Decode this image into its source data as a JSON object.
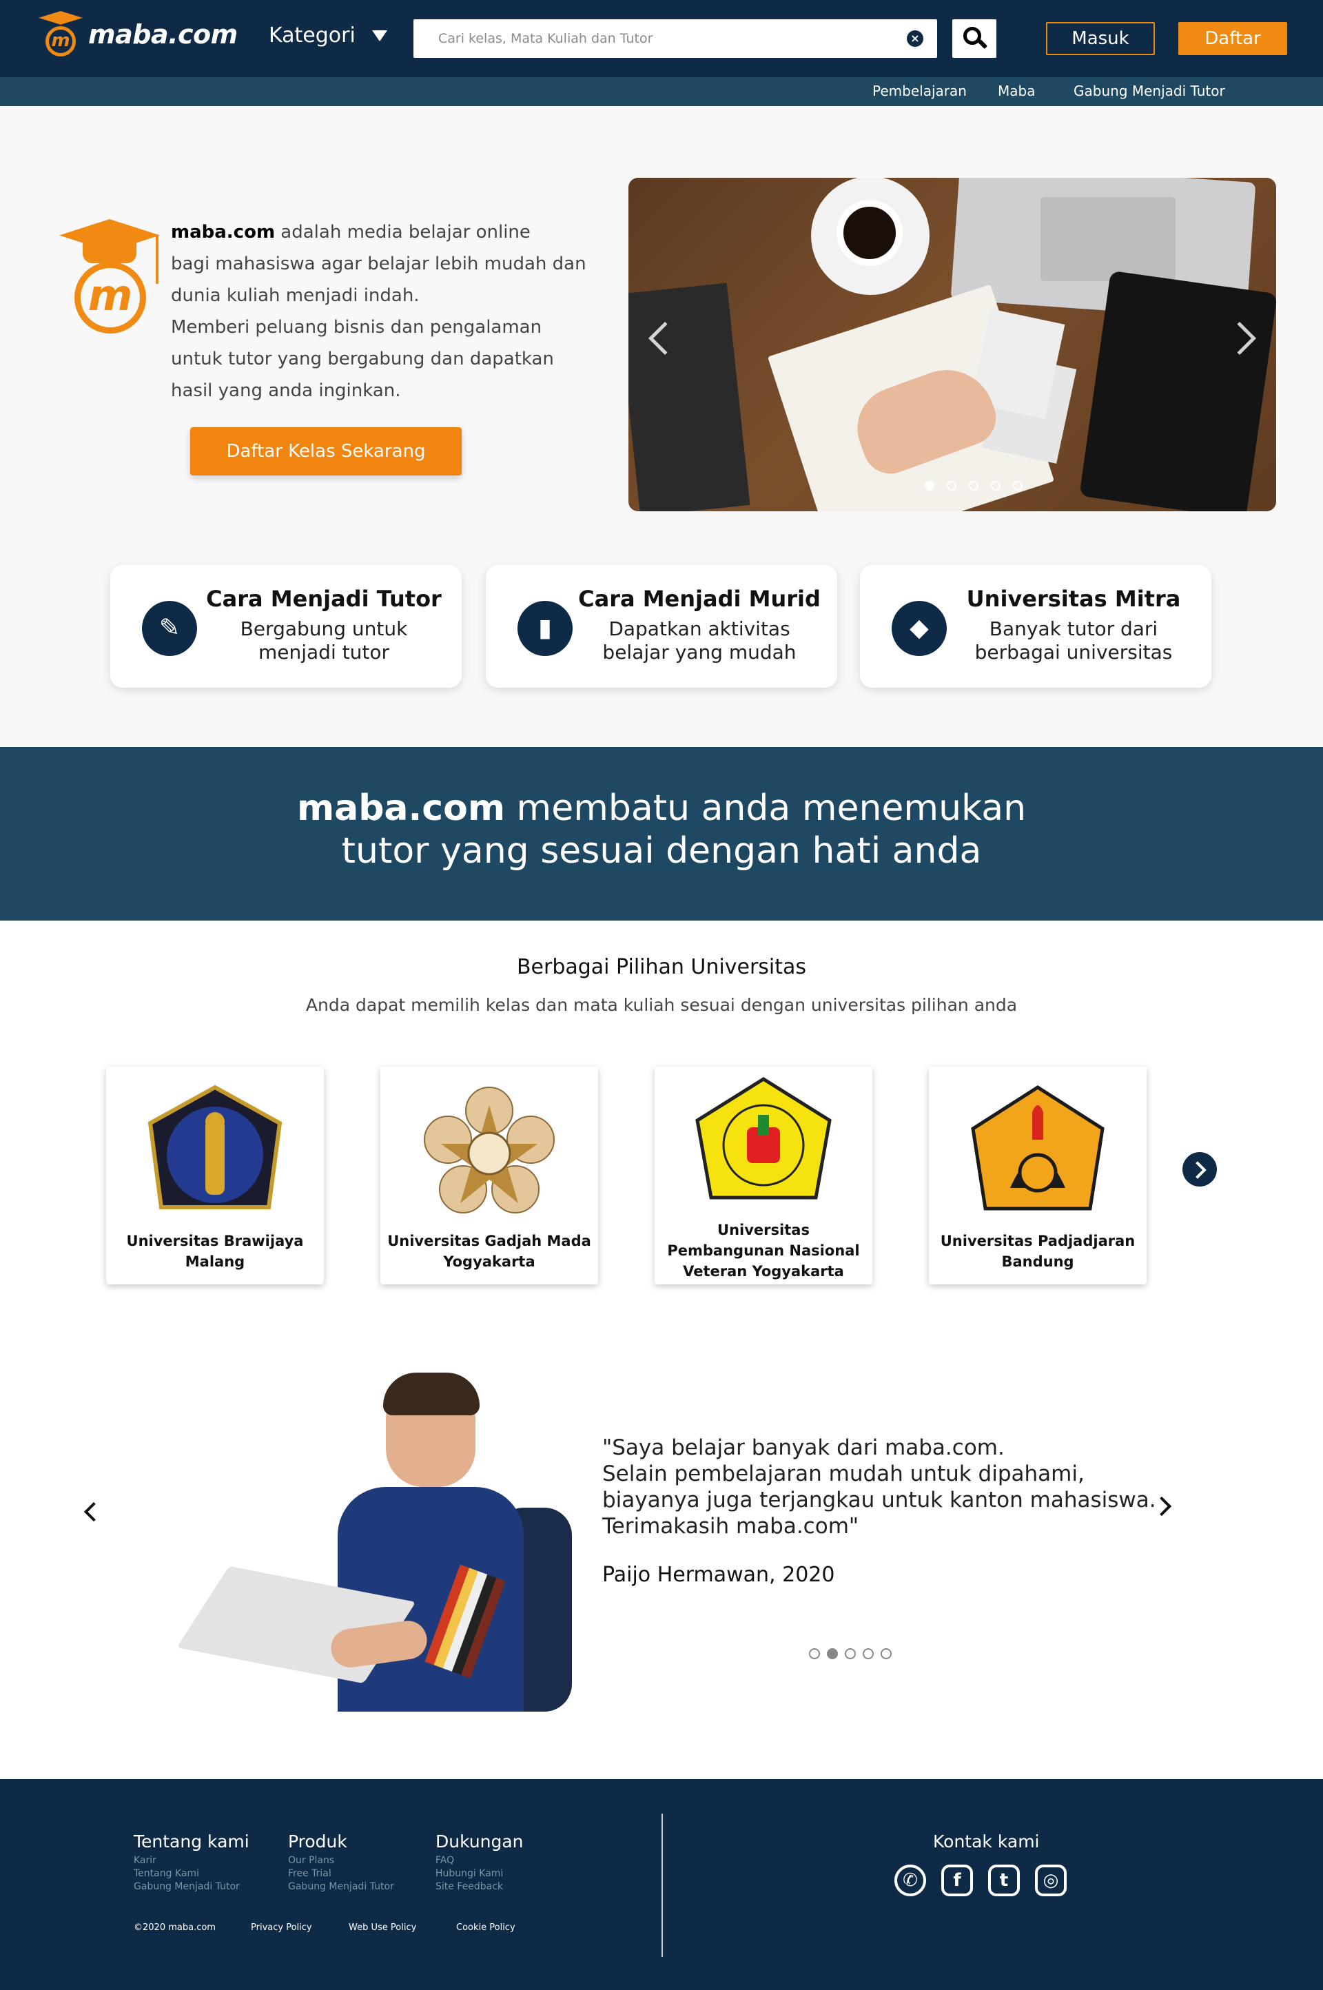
{
  "header": {
    "logo_text": "maba.com",
    "category_label": "Kategori",
    "search_placeholder": "Cari kelas, Mata Kuliah dan Tutor",
    "login_label": "Masuk",
    "register_label": "Daftar",
    "brand_orange": "#f08a13",
    "brand_navy": "#0e2a47"
  },
  "subnav": [
    {
      "label": "Pembelajaran"
    },
    {
      "label": "Maba"
    },
    {
      "label": "Gabung Menjadi Tutor"
    }
  ],
  "hero": {
    "brand": "maba.com",
    "line1_rest": " adalah media belajar online",
    "line2": "bagi mahasiswa agar belajar lebih mudah dan dunia kuliah menjadi indah.",
    "line3": "Memberi peluang bisnis dan pengalaman untuk tutor yang bergabung dan dapatkan hasil yang anda inginkan.",
    "cta_label": "Daftar Kelas Sekarang",
    "slider_dot_count": 5,
    "slider_active_index": 0
  },
  "features": [
    {
      "title": "Cara Menjadi Tutor",
      "desc": "Bergabung untuk menjadi tutor",
      "icon": "tutor-icon"
    },
    {
      "title": "Cara Menjadi Murid",
      "desc": "Dapatkan aktivitas belajar yang mudah",
      "icon": "book-icon"
    },
    {
      "title": "Universitas Mitra",
      "desc": "Banyak tutor dari berbagai universitas",
      "icon": "graduation-cap-icon"
    }
  ],
  "banner": {
    "brand": "maba.com",
    "line1_rest": " membatu anda menemukan",
    "line2": "tutor yang sesuai dengan hati anda"
  },
  "universities": {
    "title": "Berbagai Pilihan Universitas",
    "subtitle": "Anda dapat memilih kelas dan mata kuliah sesuai dengan universitas pilihan anda",
    "items": [
      {
        "name": "Universitas Brawijaya Malang"
      },
      {
        "name": "Universitas Gadjah Mada Yogyakarta"
      },
      {
        "name": "Universitas Pembangunan Nasional Veteran Yogyakarta"
      },
      {
        "name": "Universitas Padjadjaran Bandung"
      }
    ]
  },
  "testimonial": {
    "quote_lines": [
      "\"Saya belajar banyak dari maba.com.",
      "Selain pembelajaran mudah untuk dipahami,",
      "biayanya juga terjangkau untuk kanton mahasiswa.",
      "Terimakasih maba.com\""
    ],
    "author": "Paijo Hermawan, 2020",
    "dot_count": 5,
    "active_index": 1
  },
  "footer": {
    "columns": [
      {
        "title": "Tentang kami",
        "links": [
          "Karir",
          "Tentang Kami",
          "Gabung Menjadi Tutor"
        ]
      },
      {
        "title": "Produk",
        "links": [
          "Our Plans",
          "Free Trial",
          "Gabung Menjadi Tutor"
        ]
      },
      {
        "title": "Dukungan",
        "links": [
          "FAQ",
          "Hubungi Kami",
          "Site Feedback"
        ]
      }
    ],
    "legal": [
      "©2020 maba.com",
      "Privacy Policy",
      "Web Use Policy",
      "Cookie Policy"
    ],
    "contact_title": "Kontak kami",
    "socials": [
      "whatsapp-icon",
      "facebook-icon",
      "twitter-icon",
      "instagram-icon"
    ]
  }
}
